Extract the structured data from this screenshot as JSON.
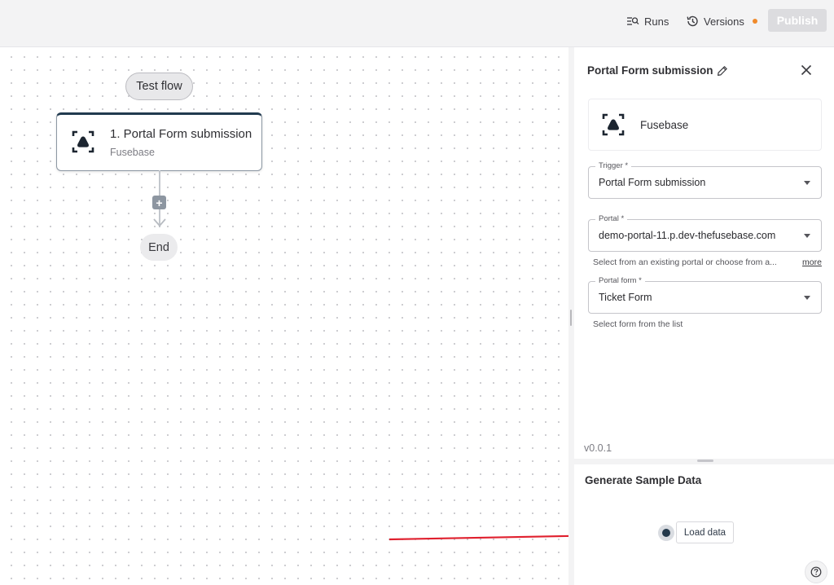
{
  "header": {
    "runs_label": "Runs",
    "versions_label": "Versions",
    "publish_label": "Publish",
    "versions_dot_color": "#f08a2b",
    "icons": {
      "runs": "runs-list-icon",
      "versions": "history-icon"
    }
  },
  "canvas": {
    "test_flow_label": "Test flow",
    "step": {
      "title": "1. Portal Form submission",
      "subtitle": "Fusebase",
      "icon": "fusebase-logo-icon"
    },
    "add_step_symbol": "+",
    "end_label": "End"
  },
  "panel": {
    "title": "Portal Form submission",
    "piece_name": "Fusebase",
    "fields": {
      "trigger": {
        "label": "Trigger *",
        "value": "Portal Form submission"
      },
      "portal": {
        "label": "Portal *",
        "value": "demo-portal-11.p.dev-thefusebase.com"
      },
      "portal_form": {
        "label": "Portal form *",
        "value": "Ticket Form"
      }
    },
    "portal_helper": "Select from an existing portal or choose from a...",
    "more_link": "more",
    "form_helper": "Select form from the list",
    "version": "v0.0.1"
  },
  "sample": {
    "title": "Generate Sample Data",
    "load_label": "Load data"
  },
  "colors": {
    "accent_dark": "#213a4f",
    "annotation_arrow": "#e0202e",
    "publish_disabled": "#dcdcdf"
  }
}
